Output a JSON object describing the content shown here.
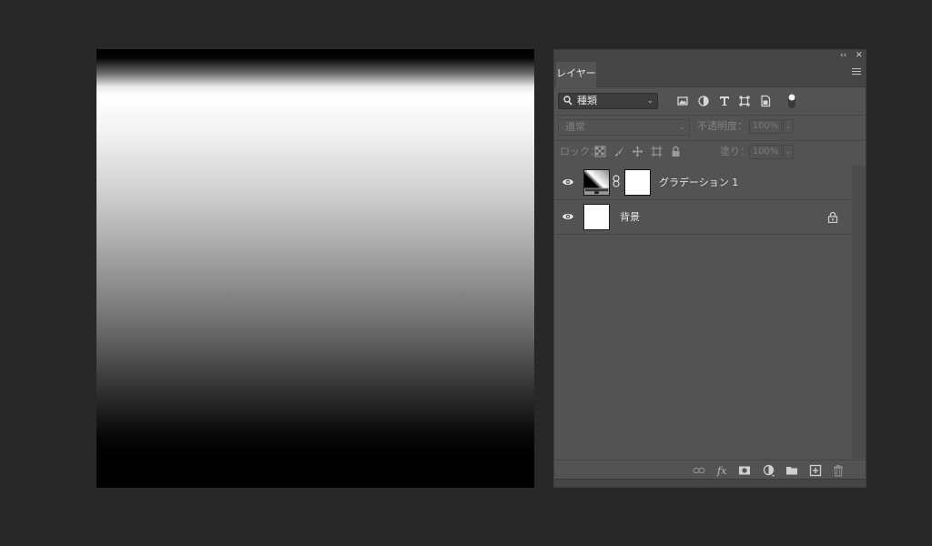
{
  "layers_panel": {
    "tab_label": "レイヤー",
    "collapse_label": "‹‹",
    "close_label": "✕",
    "filter": {
      "label": "種類",
      "type": "dropdown"
    },
    "blend_mode": "通常",
    "opacity": {
      "label": "不透明度：",
      "value": "100%"
    },
    "lock_label": "ロック：",
    "fill": {
      "label": "塗り：",
      "value": "100%"
    },
    "layers": [
      {
        "name": "グラデーション 1",
        "visible": true,
        "type": "gradient-fill",
        "has_mask": true,
        "locked": false
      },
      {
        "name": "背景",
        "visible": true,
        "type": "background",
        "has_mask": false,
        "locked": true
      }
    ],
    "bottom_icons": [
      "link-layers-icon",
      "fx-icon",
      "add-mask-icon",
      "adjustment-layer-icon",
      "group-folder-icon",
      "new-layer-icon",
      "trash-icon"
    ]
  },
  "colors": {
    "workspace_bg": "#282828",
    "panel_bg": "#535353",
    "text": "#e4e4e4",
    "dim_text": "#808080"
  }
}
